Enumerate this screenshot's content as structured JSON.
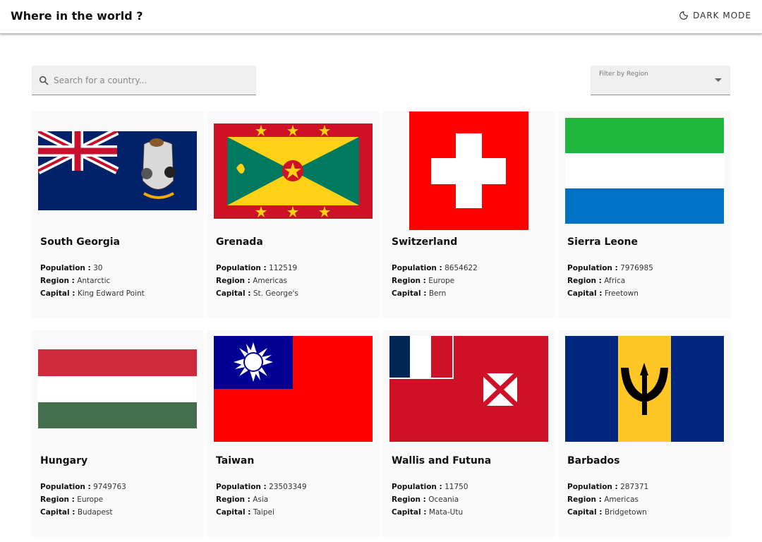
{
  "header": {
    "title": "Where in the world ?",
    "dark_mode_label": "DARK MODE"
  },
  "search": {
    "placeholder": "Search for a country..."
  },
  "filter": {
    "label": "Filter by Region"
  },
  "labels": {
    "population": "Population :",
    "region": "Region :",
    "capital": "Capital :"
  },
  "countries": [
    {
      "name": "South Georgia",
      "population": "30",
      "region": "Antarctic",
      "capital": "King Edward Point"
    },
    {
      "name": "Grenada",
      "population": "112519",
      "region": "Americas",
      "capital": "St. George's"
    },
    {
      "name": "Switzerland",
      "population": "8654622",
      "region": "Europe",
      "capital": "Bern"
    },
    {
      "name": "Sierra Leone",
      "population": "7976985",
      "region": "Africa",
      "capital": "Freetown"
    },
    {
      "name": "Hungary",
      "population": "9749763",
      "region": "Europe",
      "capital": "Budapest"
    },
    {
      "name": "Taiwan",
      "population": "23503349",
      "region": "Asia",
      "capital": "Taipei"
    },
    {
      "name": "Wallis and Futuna",
      "population": "11750",
      "region": "Oceania",
      "capital": "Mata-Utu"
    },
    {
      "name": "Barbados",
      "population": "287371",
      "region": "Americas",
      "capital": "Bridgetown"
    }
  ],
  "icons": {
    "dark_mode": "moon-icon",
    "search": "search-icon",
    "dropdown": "caret-down-icon"
  }
}
